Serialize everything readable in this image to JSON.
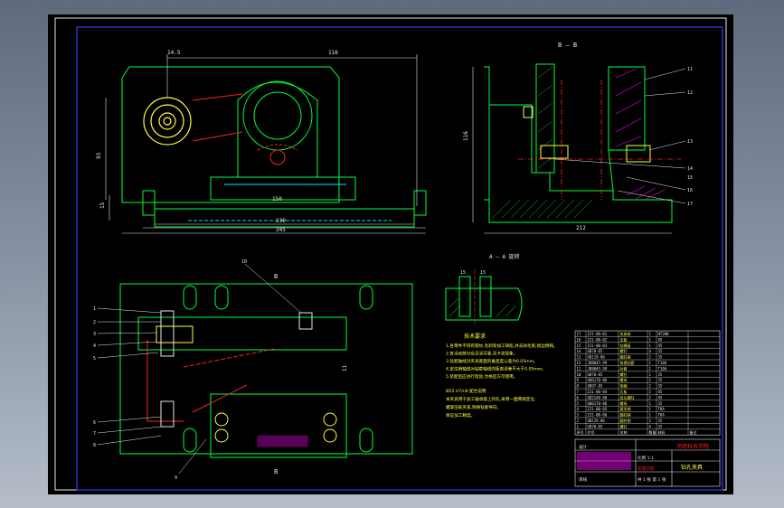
{
  "drawing": {
    "section_label": "B — B",
    "detail_label": "A — A   旋转",
    "cut_label_top": "B",
    "cut_label_bottom": "B",
    "school": "河南科技学院",
    "title": "钻孔夹具",
    "tech_req_title": "技术要求",
    "tech_req_lines": [
      "1.各零件不得有裂纹,毛刺等加工缺陷,并去除毛刺,锐边倒钝。",
      "2.各活动部分应灵活可靠,无卡滞现象。",
      "3.钻套轴线对夹具底面的垂直度公差为0.05mm。",
      "4.定位销轴线对钻套轴线的距离误差不大于0.05mm。",
      "5.装配后应进行检验,合格后方可使用。"
    ],
    "note_lines": [
      "Ø25 H7/n6 配合说明",
      "本夹具用于加工轴承座上的孔,采用一面两销定位,",
      "螺旋压板夹紧,快换钻套导向,",
      "保证加工精度。"
    ]
  },
  "dimensions": {
    "top_width": "116",
    "top_left": "14.5",
    "top_height": "93",
    "base_inner": "150",
    "base_mid": "230",
    "base_total": "245",
    "base_h": "15",
    "section_height": "116",
    "section_width": "212",
    "detail_a": "15",
    "detail_b": "15",
    "plan_side": "11"
  },
  "balloons_left": [
    "1",
    "2",
    "3",
    "4",
    "5",
    "6",
    "7",
    "8",
    "9"
  ],
  "balloon_top_plan": "10",
  "balloons_section": [
    "11",
    "12",
    "13",
    "14",
    "15",
    "16",
    "17"
  ],
  "bom_rows": [
    {
      "no": "17",
      "code": "ZJ1-00-01",
      "name": "夹具体",
      "qty": "1",
      "mat": "HT200"
    },
    {
      "no": "16",
      "code": "ZJ1-00-02",
      "name": "支板",
      "qty": "1",
      "mat": "45"
    },
    {
      "no": "15",
      "code": "ZJ1-00-03",
      "name": "钻模板",
      "qty": "1",
      "mat": "45"
    },
    {
      "no": "14",
      "code": "GB70-85",
      "name": "螺钉",
      "qty": "4",
      "mat": "35"
    },
    {
      "no": "13",
      "code": "GB119-86",
      "name": "圆柱销",
      "qty": "2",
      "mat": "35"
    },
    {
      "no": "12",
      "code": "JB8045-99",
      "name": "快换钻套",
      "qty": "1",
      "mat": "T10A"
    },
    {
      "no": "11",
      "code": "JB8045-99",
      "name": "衬套",
      "qty": "1",
      "mat": "T10A"
    },
    {
      "no": "10",
      "code": "GB70-85",
      "name": "螺钉",
      "qty": "1",
      "mat": "35"
    },
    {
      "no": "9",
      "code": "GB6170-86",
      "name": "螺母",
      "qty": "2",
      "mat": "35"
    },
    {
      "no": "8",
      "code": "GB97-85",
      "name": "垫圈",
      "qty": "2",
      "mat": "35"
    },
    {
      "no": "7",
      "code": "ZJ1-00-04",
      "name": "压板",
      "qty": "2",
      "mat": "45"
    },
    {
      "no": "6",
      "code": "GB2148-80",
      "name": "双头螺柱",
      "qty": "2",
      "mat": "45"
    },
    {
      "no": "5",
      "code": "GB6170-86",
      "name": "螺母",
      "qty": "1",
      "mat": "35"
    },
    {
      "no": "4",
      "code": "ZJ1-00-05",
      "name": "菱形销",
      "qty": "1",
      "mat": "T8A"
    },
    {
      "no": "3",
      "code": "ZJ1-00-06",
      "name": "圆柱销",
      "qty": "1",
      "mat": "T8A"
    },
    {
      "no": "2",
      "code": "GB119-86",
      "name": "圆柱销",
      "qty": "2",
      "mat": "35"
    },
    {
      "no": "1",
      "code": "GB70-85",
      "name": "螺钉",
      "qty": "4",
      "mat": "35"
    }
  ],
  "bom_header": {
    "no": "序号",
    "code": "代号",
    "name": "名称",
    "qty": "数量",
    "mat": "材料",
    "note": "备注"
  },
  "title_block": {
    "designer": "设计",
    "checker": "审核",
    "scale_label": "比例 1:1",
    "sheet_label": "共 1 张 第 1 张",
    "dept": "机电学院"
  },
  "colors": {
    "outline": "#00ff3c",
    "cyan": "#00e5ff",
    "red": "#ff2020",
    "magenta": "#ff00ff",
    "white": "#e8e8e8",
    "blue": "#3a3aff",
    "yellow": "#ffff40"
  }
}
